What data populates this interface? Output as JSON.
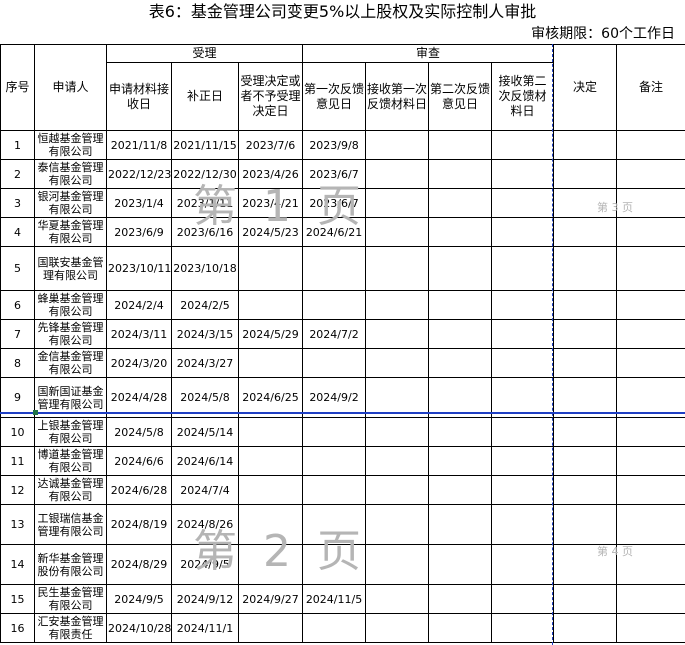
{
  "title": "表6：基金管理公司变更5%以上股权及实际控制人审批",
  "period": "审核期限：60个工作日",
  "headers": {
    "no": "序号",
    "applicant": "申请人",
    "group_accept": "受理",
    "group_review": "审查",
    "receive_date": "申请材料接收日",
    "supplement_date": "补正日",
    "accept_decision_date": "受理决定或者不予受理决定日",
    "first_feedback_date": "第一次反馈意见日",
    "first_feedback_receive": "接收第一次反馈材料日",
    "second_feedback_date": "第二次反馈意见日",
    "second_feedback_receive": "接收第二次反馈材料日",
    "decision": "决定",
    "remark": "备注"
  },
  "rows": [
    {
      "no": "1",
      "name": "恒越基金管理有限公司",
      "c1": "2021/11/8",
      "c2": "2021/11/15",
      "c3": "2023/7/6",
      "c4": "2023/9/8"
    },
    {
      "no": "2",
      "name": "泰信基金管理有限公司",
      "c1": "2022/12/23",
      "c2": "2022/12/30",
      "c3": "2023/4/26",
      "c4": "2023/6/7"
    },
    {
      "no": "3",
      "name": "银河基金管理有限公司",
      "c1": "2023/1/4",
      "c2": "2023/1/11",
      "c3": "2023/4/21",
      "c4": "2023/6/7"
    },
    {
      "no": "4",
      "name": "华夏基金管理有限公司",
      "c1": "2023/6/9",
      "c2": "2023/6/16",
      "c3": "2024/5/23",
      "c4": "2024/6/21"
    },
    {
      "no": "5",
      "name": "国联安基金管理有限公司",
      "c1": "2023/10/11",
      "c2": "2023/10/18",
      "c3": "",
      "c4": ""
    },
    {
      "no": "6",
      "name": "蜂巢基金管理有限公司",
      "c1": "2024/2/4",
      "c2": "2024/2/5",
      "c3": "",
      "c4": ""
    },
    {
      "no": "7",
      "name": "先锋基金管理有限公司",
      "c1": "2024/3/11",
      "c2": "2024/3/15",
      "c3": "2024/5/29",
      "c4": "2024/7/2"
    },
    {
      "no": "8",
      "name": "金信基金管理有限公司",
      "c1": "2024/3/20",
      "c2": "2024/3/27",
      "c3": "",
      "c4": ""
    },
    {
      "no": "9",
      "name": "国新国证基金管理有限公司",
      "c1": "2024/4/28",
      "c2": "2024/5/8",
      "c3": "2024/6/25",
      "c4": "2024/9/2"
    },
    {
      "no": "10",
      "name": "上银基金管理有限公司",
      "c1": "2024/5/8",
      "c2": "2024/5/14",
      "c3": "",
      "c4": ""
    },
    {
      "no": "11",
      "name": "博道基金管理有限公司",
      "c1": "2024/6/6",
      "c2": "2024/6/14",
      "c3": "",
      "c4": ""
    },
    {
      "no": "12",
      "name": "达诚基金管理有限公司",
      "c1": "2024/6/28",
      "c2": "2024/7/4",
      "c3": "",
      "c4": ""
    },
    {
      "no": "13",
      "name": "工银瑞信基金管理有限公司",
      "c1": "2024/8/19",
      "c2": "2024/8/26",
      "c3": "",
      "c4": ""
    },
    {
      "no": "14",
      "name": "新华基金管理股份有限公司",
      "c1": "2024/8/29",
      "c2": "2024/9/5",
      "c3": "",
      "c4": ""
    },
    {
      "no": "15",
      "name": "民生基金管理有限公司",
      "c1": "2024/9/5",
      "c2": "2024/9/12",
      "c3": "2024/9/27",
      "c4": "2024/11/5"
    },
    {
      "no": "16",
      "name": "汇安基金管理有限责任",
      "c1": "2024/10/28",
      "c2": "2024/11/1",
      "c3": "",
      "c4": ""
    }
  ],
  "watermarks": {
    "page1_big": "第 1 页",
    "page2_big": "第 2 页",
    "page3_small": "第 3 页",
    "page4_small": "第 4 页"
  }
}
